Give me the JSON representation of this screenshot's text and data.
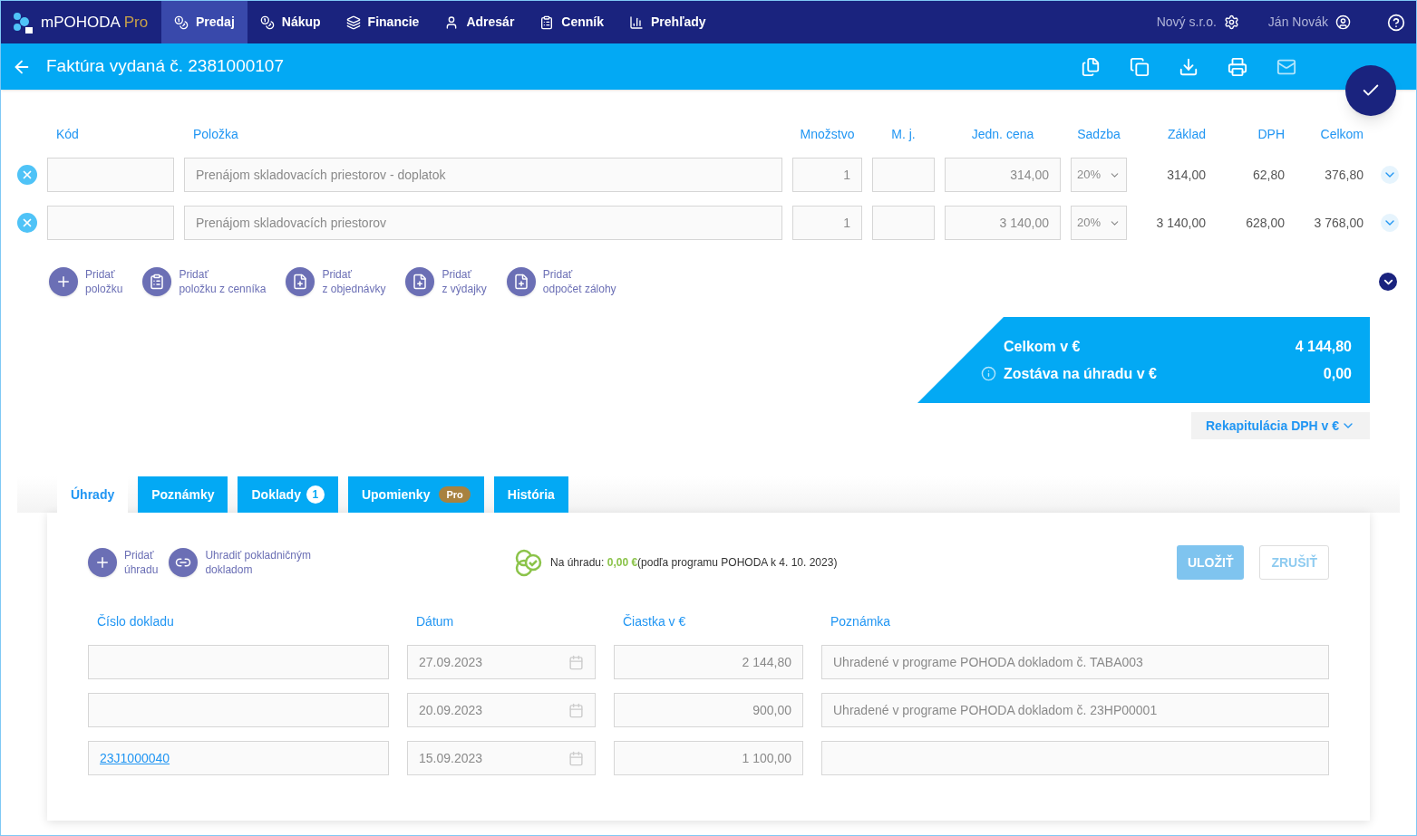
{
  "nav": {
    "logo": "mPOHODA",
    "logo_suffix": "Pro",
    "items": [
      {
        "label": "Predaj",
        "selected": true
      },
      {
        "label": "Nákup",
        "selected": false
      },
      {
        "label": "Financie",
        "selected": false
      },
      {
        "label": "Adresár",
        "selected": false
      },
      {
        "label": "Cenník",
        "selected": false
      },
      {
        "label": "Prehľady",
        "selected": false
      }
    ],
    "company": "Nový s.r.o.",
    "user": "Ján Novák"
  },
  "header": {
    "title": "Faktúra vydaná č. 2381000107"
  },
  "items_table": {
    "columns": [
      "Kód",
      "Položka",
      "Množstvo",
      "M. j.",
      "Jedn. cena",
      "Sadzba",
      "Základ",
      "DPH",
      "Celkom"
    ],
    "rows": [
      {
        "item": "Prenájom skladovacích priestorov - doplatok",
        "quantity": "1",
        "unit_price": "314,00",
        "rate": "20%",
        "base": "314,00",
        "vat": "62,80",
        "total": "376,80"
      },
      {
        "item": "Prenájom skladovacích priestorov",
        "quantity": "1",
        "unit_price": "3 140,00",
        "rate": "20%",
        "base": "3 140,00",
        "vat": "628,00",
        "total": "3 768,00"
      }
    ]
  },
  "add_actions": [
    {
      "lines": [
        "Pridať",
        "položku"
      ]
    },
    {
      "lines": [
        "Pridať",
        "položku z cenníka"
      ]
    },
    {
      "lines": [
        "Pridať",
        "z objednávky"
      ]
    },
    {
      "lines": [
        "Pridať",
        "z výdajky"
      ]
    },
    {
      "lines": [
        "Pridať",
        "odpočet zálohy"
      ]
    }
  ],
  "summary": {
    "rows": [
      {
        "label": "Celkom v €",
        "value": "4 144,80",
        "info": false
      },
      {
        "label": "Zostáva na úhradu v €",
        "value": "0,00",
        "info": true
      }
    ]
  },
  "vat_recap": {
    "label": "Rekapitulácia DPH v €"
  },
  "tabs": [
    {
      "label": "Úhrady",
      "selected": true
    },
    {
      "label": "Poznámky",
      "selected": false
    },
    {
      "label": "Doklady",
      "selected": false,
      "badge": {
        "text": "1",
        "kind": "count"
      }
    },
    {
      "label": "Upomienky",
      "selected": false,
      "badge": {
        "text": "Pro",
        "kind": "pro"
      }
    },
    {
      "label": "História",
      "selected": false
    }
  ],
  "payments": {
    "actions": [
      {
        "lines": [
          "Pridať",
          "úhradu"
        ]
      },
      {
        "lines": [
          "Uhradiť pokladničným",
          "dokladom"
        ]
      }
    ],
    "status": {
      "prefix": "Na úhradu: ",
      "amount": "0,00 €",
      "suffix": "(podľa programu POHODA k 4. 10. 2023)"
    },
    "buttons": [
      {
        "label": "ULOŽIŤ",
        "kind": "primary",
        "disabled": true
      },
      {
        "label": "ZRUŠIŤ",
        "kind": "secondary",
        "disabled": true
      }
    ],
    "columns": [
      "Číslo dokladu",
      "Dátum",
      "Čiastka v €",
      "Poznámka"
    ],
    "rows": [
      {
        "date": "27.09.2023",
        "amount": "2 144,80",
        "note": "Uhradené v programe POHODA dokladom č. TABA003"
      },
      {
        "date": "20.09.2023",
        "amount": "900,00",
        "note": "Uhradené v programe POHODA dokladom č. 23HP00001"
      },
      {
        "document": "23J1000040",
        "date": "15.09.2023",
        "amount": "1 100,00"
      }
    ]
  }
}
